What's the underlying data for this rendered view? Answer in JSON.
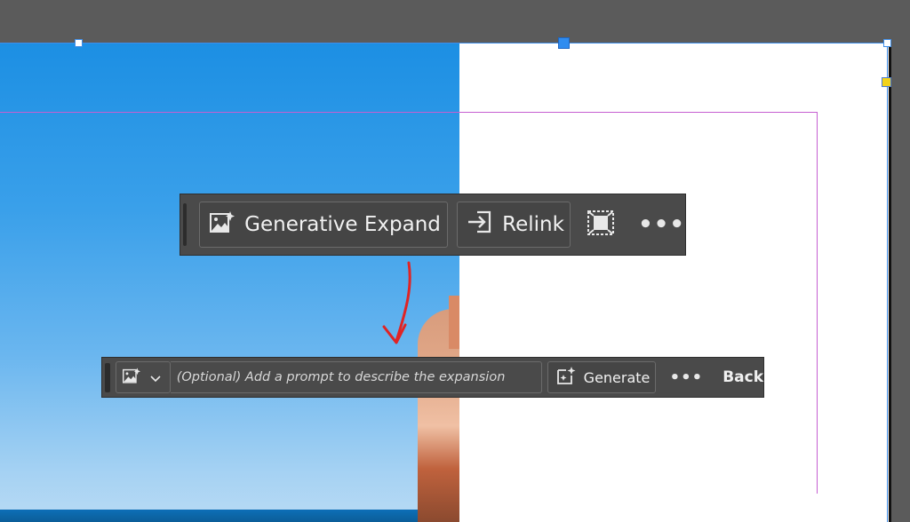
{
  "toolbar_primary": {
    "generative_expand_label": "Generative Expand",
    "generative_expand_icon": "image-sparkle-icon",
    "relink_label": "Relink",
    "relink_icon": "relink-icon",
    "crop_icon": "frame-fit-icon",
    "more_label": "•••"
  },
  "toolbar_expand": {
    "image_icon": "image-sparkle-icon",
    "dropdown_icon": "chevron-down-icon",
    "prompt_placeholder": "(Optional) Add a prompt to describe the expansion",
    "prompt_value": "",
    "generate_label": "Generate",
    "generate_icon": "generate-sparkle-icon",
    "more_label": "•••",
    "back_label": "Back"
  },
  "colors": {
    "pasteboard": "#5b5b5b",
    "toolbar_bg": "#4a4a4a",
    "margin_guide": "#c65fd1",
    "frame_selection": "#3f8ee8",
    "annotation_arrow": "#e02424"
  }
}
